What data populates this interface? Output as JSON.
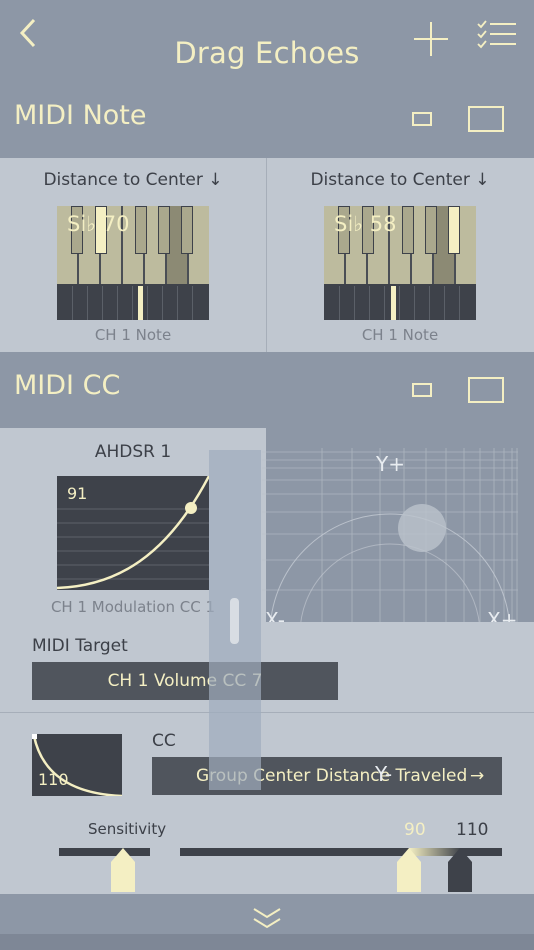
{
  "header": {
    "title": "Drag Echoes"
  },
  "midi_note": {
    "title": "MIDI Note",
    "cards": [
      {
        "label": "Distance to Center ↓",
        "note": "Si♭ 70",
        "caption": "CH 1 Note"
      },
      {
        "label": "Distance to Center ↓",
        "note": "Si♭ 58",
        "caption": "CH 1 Note"
      }
    ]
  },
  "midi_cc": {
    "title": "MIDI CC",
    "ahdsr_title": "AHDSR 1",
    "ahdsr_value": "91",
    "ahdsr_caption": "CH 1 Modulation CC 1",
    "target_label": "MIDI Target",
    "target_value": "CH 1 Volume CC 7",
    "cc_label": "CC",
    "cc_value": "Group Center Distance Traveled",
    "cc_arrow": "→",
    "curve_value": "110",
    "sensitivity_label": "Sensitivity",
    "range_low": "90",
    "range_high": "110"
  },
  "xy_pad": {
    "y_plus": "Y+",
    "y_minus": "Y-",
    "x_minus": "X-",
    "x_plus": "X+"
  },
  "colors": {
    "accent": "#f4efc3",
    "panel": "#c0c7d0",
    "header": "#8d97a6",
    "dark": "#3e424a"
  }
}
